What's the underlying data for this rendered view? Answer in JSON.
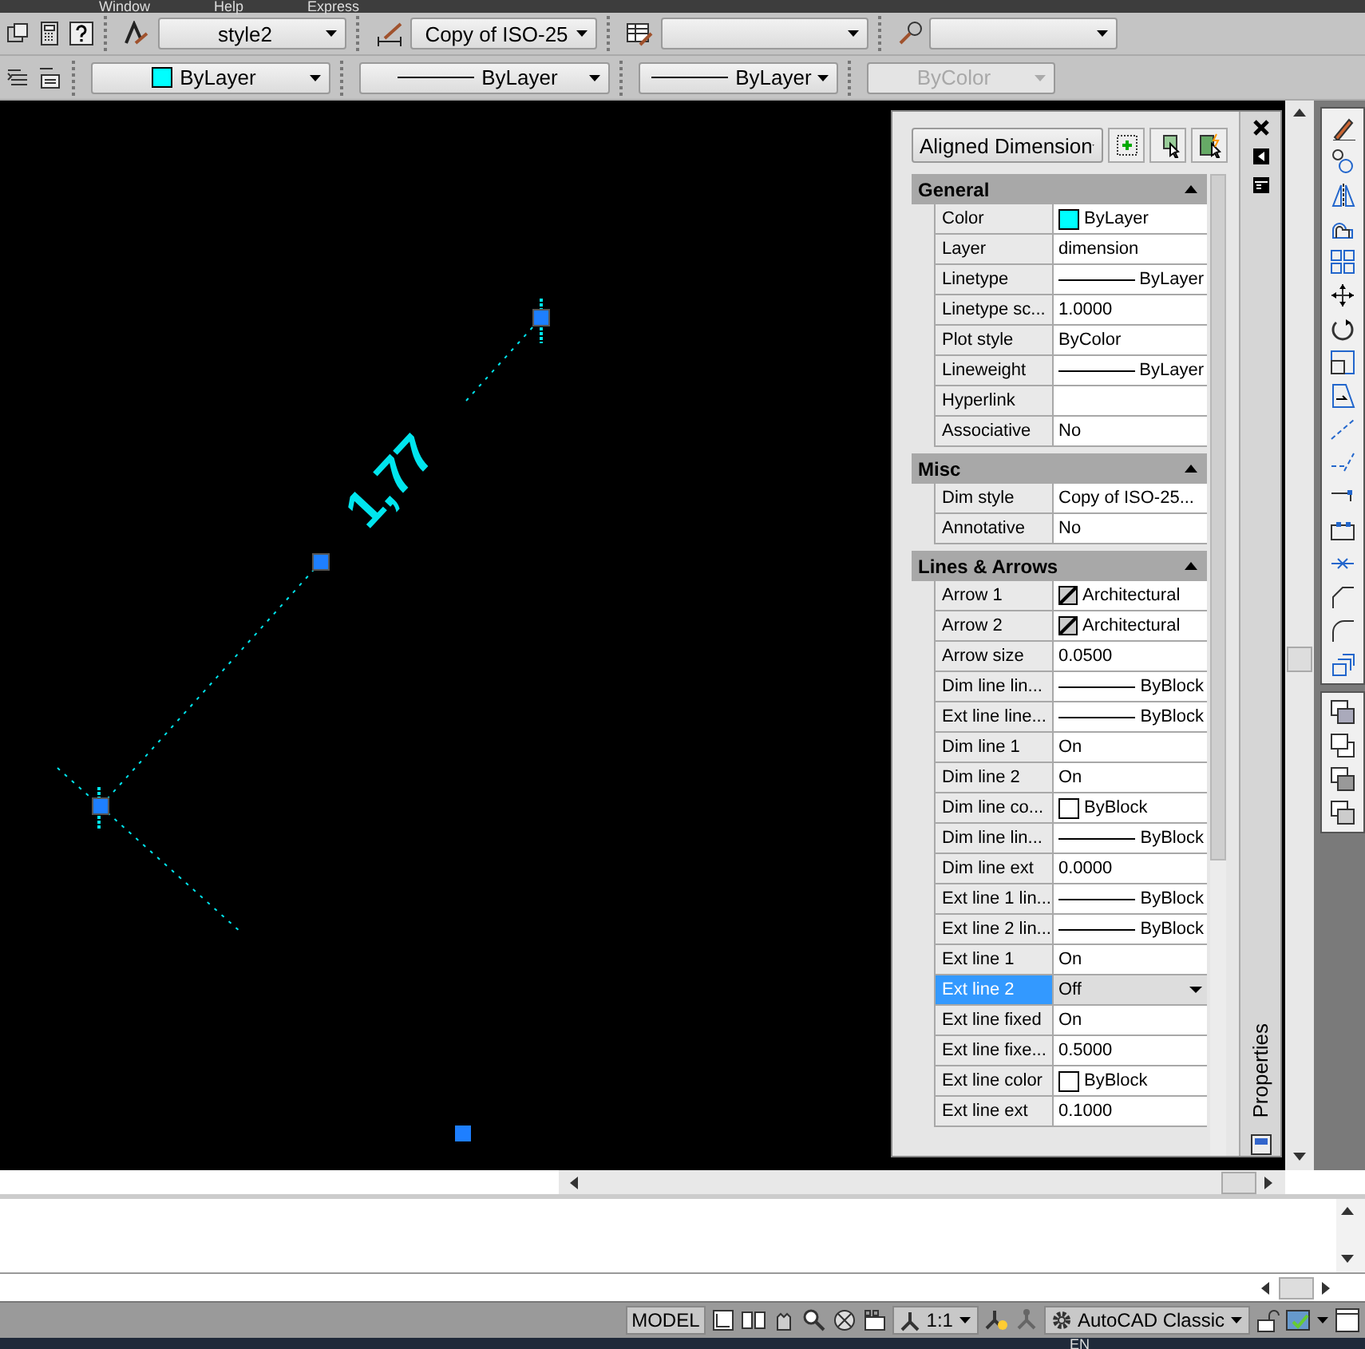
{
  "menu_bar": {
    "items": [
      "Window",
      "Help",
      "Express"
    ]
  },
  "toolbar_styles": {
    "text_style": "style2",
    "dim_style": "Copy of ISO-25"
  },
  "toolbar_properties": {
    "color": {
      "label": "ByLayer",
      "color": "#00ffff"
    },
    "linetype": "ByLayer",
    "lineweight": "ByLayer",
    "plot_style": {
      "label": "ByColor",
      "disabled": true
    }
  },
  "drawing": {
    "dimension_text": "1,77"
  },
  "properties": {
    "title": "Properties",
    "object_type": "Aligned Dimension",
    "sections": [
      {
        "title": "General",
        "expanded": true,
        "rows": [
          {
            "label": "Color",
            "value": "ByLayer",
            "kind": "color",
            "color": "#00ffff",
            "selected": false
          },
          {
            "label": "Layer",
            "value": "dimension",
            "kind": "text",
            "selected": false
          },
          {
            "label": "Linetype",
            "value": "ByLayer",
            "kind": "line",
            "selected": false
          },
          {
            "label": "Linetype sc...",
            "value": "1.0000",
            "kind": "text",
            "selected": false
          },
          {
            "label": "Plot style",
            "value": "ByColor",
            "kind": "text",
            "selected": false
          },
          {
            "label": "Lineweight",
            "value": "ByLayer",
            "kind": "line",
            "selected": false
          },
          {
            "label": "Hyperlink",
            "value": "",
            "kind": "text",
            "selected": false
          },
          {
            "label": "Associative",
            "value": "No",
            "kind": "text",
            "selected": false
          }
        ]
      },
      {
        "title": "Misc",
        "expanded": true,
        "rows": [
          {
            "label": "Dim style",
            "value": "Copy of ISO-25...",
            "kind": "text",
            "selected": false
          },
          {
            "label": "Annotative",
            "value": "No",
            "kind": "text",
            "selected": false
          }
        ]
      },
      {
        "title": "Lines & Arrows",
        "expanded": true,
        "rows": [
          {
            "label": "Arrow 1",
            "value": "Architectural",
            "kind": "arrow",
            "selected": false
          },
          {
            "label": "Arrow 2",
            "value": "Architectural",
            "kind": "arrow",
            "selected": false
          },
          {
            "label": "Arrow size",
            "value": "0.0500",
            "kind": "text",
            "selected": false
          },
          {
            "label": "Dim line lin...",
            "value": "ByBlock",
            "kind": "line",
            "selected": false
          },
          {
            "label": "Ext line line...",
            "value": "ByBlock",
            "kind": "line",
            "selected": false
          },
          {
            "label": "Dim line 1",
            "value": "On",
            "kind": "text",
            "selected": false
          },
          {
            "label": "Dim line 2",
            "value": "On",
            "kind": "text",
            "selected": false
          },
          {
            "label": "Dim line co...",
            "value": "ByBlock",
            "kind": "color",
            "color": "#ffffff",
            "selected": false
          },
          {
            "label": "Dim line lin...",
            "value": "ByBlock",
            "kind": "line",
            "selected": false
          },
          {
            "label": "Dim line ext",
            "value": "0.0000",
            "kind": "text",
            "selected": false
          },
          {
            "label": "Ext line 1 lin...",
            "value": "ByBlock",
            "kind": "line",
            "selected": false
          },
          {
            "label": "Ext line 2 lin...",
            "value": "ByBlock",
            "kind": "line",
            "selected": false
          },
          {
            "label": "Ext line 1",
            "value": "On",
            "kind": "text",
            "selected": false
          },
          {
            "label": "Ext line 2",
            "value": "Off",
            "kind": "text",
            "selected": true
          },
          {
            "label": "Ext line fixed",
            "value": "On",
            "kind": "text",
            "selected": false
          },
          {
            "label": "Ext line fixe...",
            "value": "0.5000",
            "kind": "text",
            "selected": false
          },
          {
            "label": "Ext line color",
            "value": "ByBlock",
            "kind": "color",
            "color": "#ffffff",
            "selected": false
          },
          {
            "label": "Ext line ext",
            "value": "0.1000",
            "kind": "text",
            "selected": false
          }
        ]
      }
    ]
  },
  "status_bar": {
    "space": "MODEL",
    "annotation_scale": "1:1",
    "workspace": "AutoCAD Classic"
  },
  "taskbar": {
    "language": "EN"
  }
}
